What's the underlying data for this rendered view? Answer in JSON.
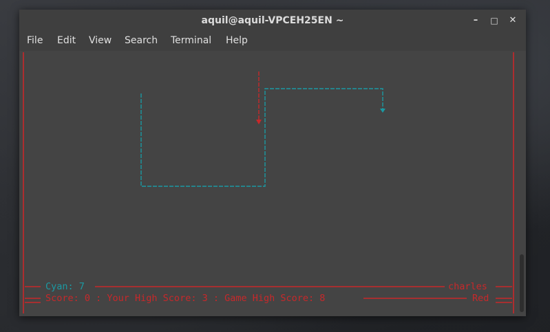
{
  "window": {
    "title": "aquil@aquil-VPCEH25EN ~",
    "minimize_glyph": "–",
    "maximize_glyph": "□",
    "close_glyph": "✕"
  },
  "menu": [
    "File",
    "Edit",
    "View",
    "Search",
    "Terminal",
    "Help"
  ],
  "colors": {
    "border": "#c8282a",
    "cyan": "#1b9aa3",
    "red_text": "#c8282a",
    "terminal_bg": "#444444"
  },
  "game": {
    "cyan_label": "Cyan: 7",
    "opponent_name": "charles",
    "score_line": "Score: 0 : Your High Score: 3 : Game High Score: 8",
    "red_label": "Red"
  }
}
